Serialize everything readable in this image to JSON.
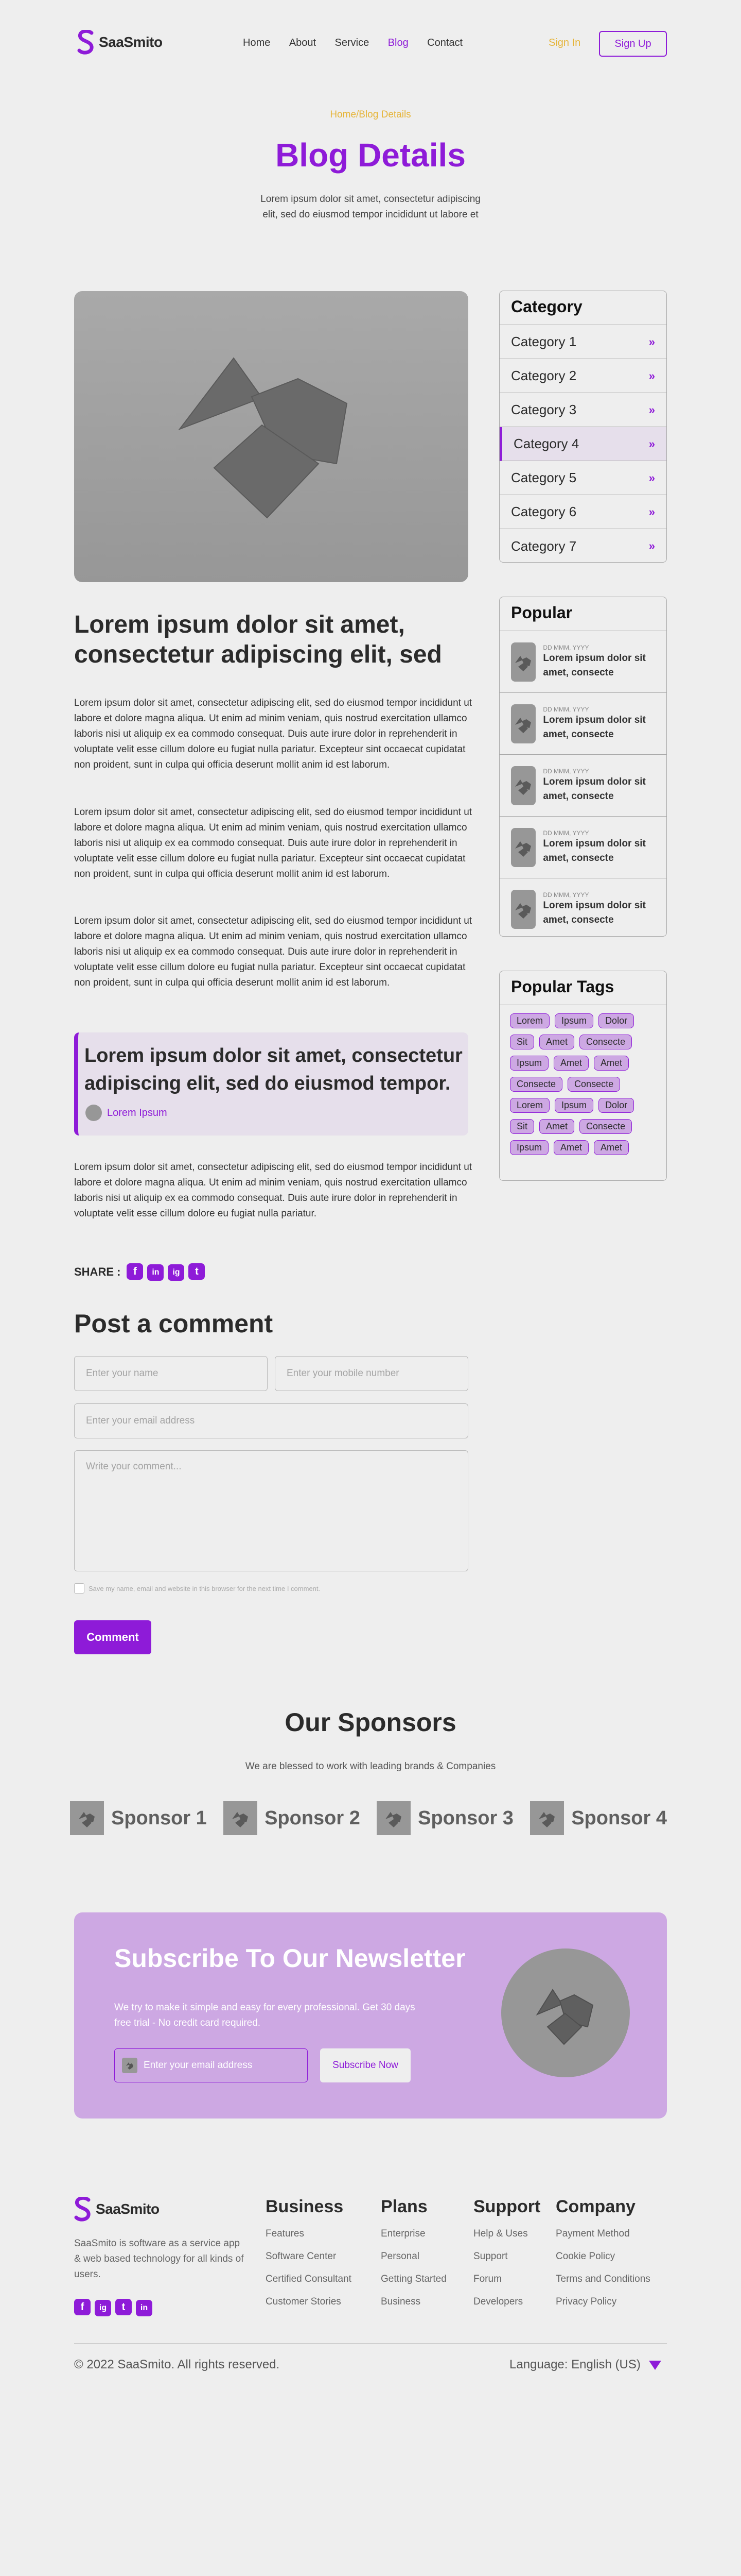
{
  "brand": {
    "name": "SaaSmito",
    "accent": "#8E1BD8",
    "gold": "#E6B53A"
  },
  "nav": {
    "items": [
      "Home",
      "About",
      "Service",
      "Blog",
      "Contact"
    ],
    "active": "Blog",
    "sign_in": "Sign In",
    "sign_up": "Sign Up"
  },
  "hero": {
    "breadcrumb": "Home/Blog Details",
    "title": "Blog Details",
    "subtitle_line1": "Lorem ipsum dolor sit amet, consectetur adipiscing",
    "subtitle_line2": "elit, sed do eiusmod tempor incididunt ut labore et"
  },
  "article": {
    "title": "Lorem ipsum dolor sit amet, consectetur adipiscing elit, sed",
    "paragraphs": [
      "Lorem ipsum dolor sit amet, consectetur adipiscing elit, sed do eiusmod tempor incididunt ut labore et dolore magna aliqua. Ut enim ad minim veniam, quis nostrud exercitation ullamco laboris nisi ut aliquip ex ea commodo consequat. Duis aute irure dolor in reprehenderit in voluptate velit esse cillum dolore eu fugiat nulla pariatur. Excepteur sint occaecat cupidatat non proident, sunt in culpa qui officia deserunt mollit anim id est laborum.",
      "Lorem ipsum dolor sit amet, consectetur adipiscing elit, sed do eiusmod tempor incididunt ut labore et dolore magna aliqua. Ut enim ad minim veniam, quis nostrud exercitation ullamco laboris nisi ut aliquip ex ea commodo consequat. Duis aute irure dolor in reprehenderit in voluptate velit esse cillum dolore eu fugiat nulla pariatur. Excepteur sint occaecat cupidatat non proident, sunt in culpa qui officia deserunt mollit anim id est laborum.",
      "Lorem ipsum dolor sit amet, consectetur adipiscing elit, sed do eiusmod tempor incididunt ut labore et dolore magna aliqua. Ut enim ad minim veniam, quis nostrud exercitation ullamco laboris nisi ut aliquip ex ea commodo consequat. Duis aute irure dolor in reprehenderit in voluptate velit esse cillum dolore eu fugiat nulla pariatur. Excepteur sint occaecat cupidatat non proident, sunt in culpa qui officia deserunt mollit anim id est laborum.",
      "Lorem ipsum dolor sit amet, consectetur adipiscing elit, sed do eiusmod tempor incididunt ut labore et dolore magna aliqua. Ut enim ad minim veniam, quis nostrud exercitation ullamco laboris nisi ut aliquip ex ea commodo consequat. Duis aute irure dolor in reprehenderit in voluptate velit esse cillum dolore eu fugiat nulla pariatur."
    ],
    "quote": "Lorem ipsum dolor sit amet, consectetur adipiscing elit, sed do eiusmod tempor.",
    "quote_author": "Lorem Ipsum",
    "share_label": "SHARE :",
    "share_icons": [
      "f",
      "in",
      "ig",
      "t"
    ]
  },
  "comment_form": {
    "title": "Post a comment",
    "name_placeholder": "Enter your name",
    "mobile_placeholder": "Enter your mobile number",
    "email_placeholder": "Enter your email address",
    "comment_placeholder": "Write your comment...",
    "save_label": "Save my name, email and website in this browser for the next time I comment.",
    "submit": "Comment"
  },
  "sidebar": {
    "category_title": "Category",
    "categories": [
      "Category 1",
      "Category 2",
      "Category 3",
      "Category 4",
      "Category 5",
      "Category 6",
      "Category 7"
    ],
    "active_category": "Category 4",
    "arrow": "»",
    "popular_title": "Popular",
    "popular": [
      {
        "date": "DD MMM, YYYY",
        "title": "Lorem ipsum dolor sit amet, consecte"
      },
      {
        "date": "DD MMM, YYYY",
        "title": "Lorem ipsum dolor sit amet, consecte"
      },
      {
        "date": "DD MMM, YYYY",
        "title": "Lorem ipsum dolor sit amet, consecte"
      },
      {
        "date": "DD MMM, YYYY",
        "title": "Lorem ipsum dolor sit amet, consecte"
      },
      {
        "date": "DD MMM, YYYY",
        "title": "Lorem ipsum dolor sit amet, consecte"
      }
    ],
    "tags_title": "Popular Tags",
    "tags": [
      "Lorem",
      "Ipsum",
      "Dolor",
      "Sit",
      "Amet",
      "Consecte",
      "Ipsum",
      "Amet",
      "Amet",
      "Consecte",
      "Consecte",
      "Lorem",
      "Ipsum",
      "Dolor",
      "Sit",
      "Amet",
      "Consecte",
      "Ipsum",
      "Amet",
      "Amet"
    ]
  },
  "sponsors": {
    "title": "Our Sponsors",
    "subtitle": "We are blessed to work with leading brands & Companies",
    "items": [
      "Sponsor 1",
      "Sponsor 2",
      "Sponsor 3",
      "Sponsor 4"
    ]
  },
  "newsletter": {
    "title": "Subscribe To Our Newsletter",
    "text_line1": "We try to make it simple and easy for every professional. Get 30 days",
    "text_line2": "free trial - No credit card required.",
    "email_placeholder": "Enter your email address",
    "button": "Subscribe Now"
  },
  "footer": {
    "description": "SaaSmito is software as a service app & web based technology for all kinds of users.",
    "social_icons": [
      "f",
      "ig",
      "t",
      "in"
    ],
    "columns": [
      {
        "title": "Business",
        "links": [
          "Features",
          "Software Center",
          "Certified Consultant",
          "Customer Stories"
        ]
      },
      {
        "title": "Plans",
        "links": [
          "Enterprise",
          "Personal",
          "Getting Started",
          "Business"
        ]
      },
      {
        "title": "Support",
        "links": [
          "Help & Uses",
          "Support",
          "Forum",
          "Developers"
        ]
      },
      {
        "title": "Company",
        "links": [
          "Payment Method",
          "Cookie Policy",
          "Terms and Conditions",
          "Privacy Policy"
        ]
      }
    ],
    "copyright": "© 2022 SaaSmito. All rights reserved.",
    "language": "Language: English (US)"
  }
}
